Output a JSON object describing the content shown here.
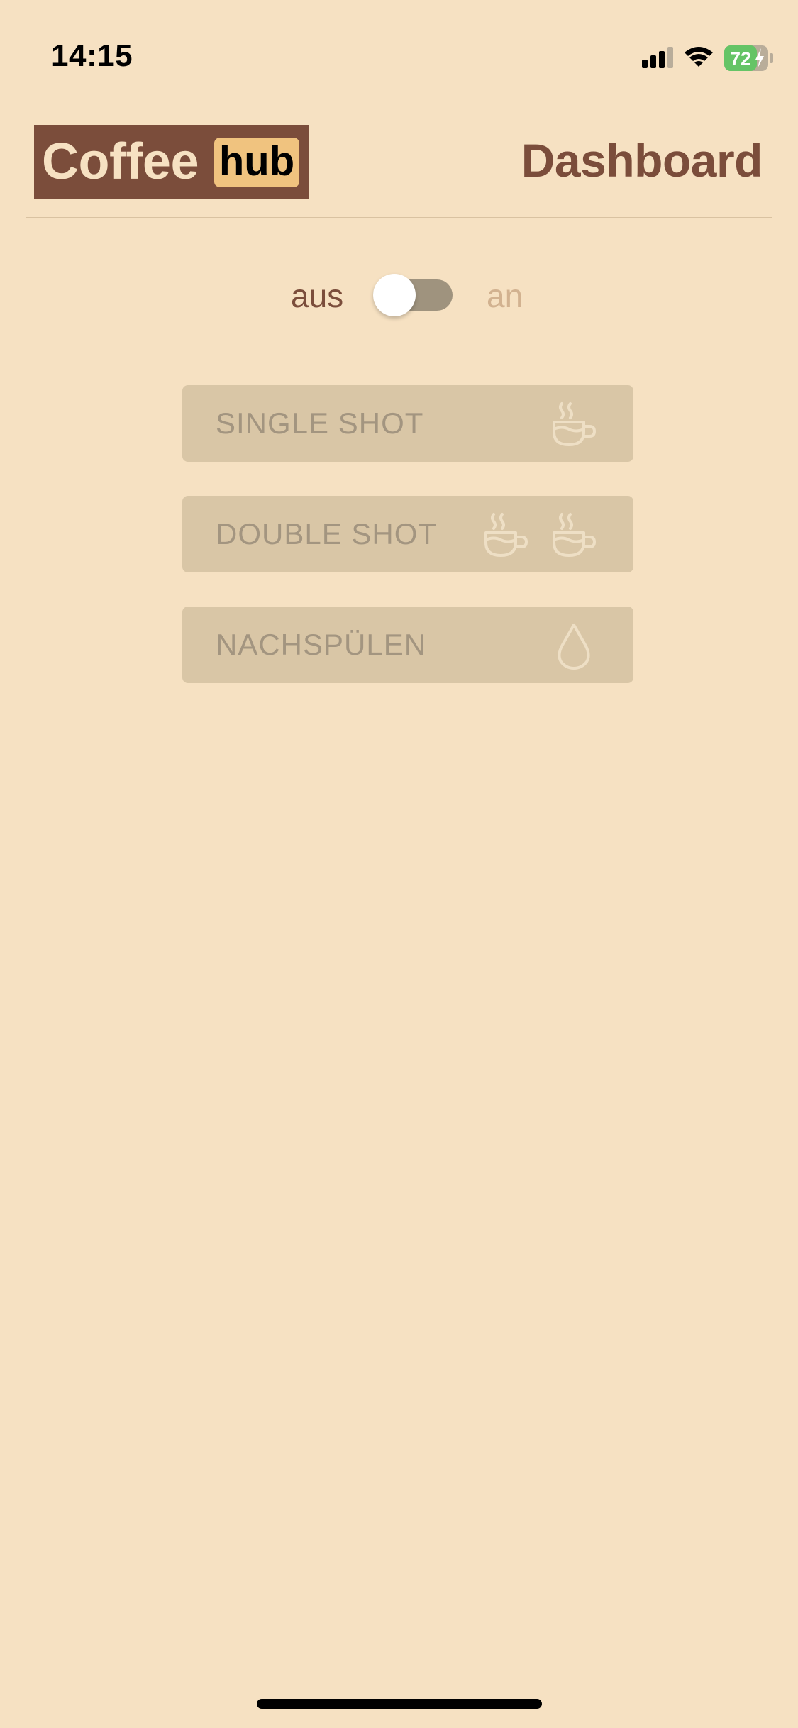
{
  "status_bar": {
    "time": "14:15",
    "battery_level": "72",
    "icons": [
      "signal-icon",
      "wifi-icon",
      "battery-icon"
    ]
  },
  "header": {
    "logo_part1": "Coffee",
    "logo_part2": "hub",
    "page_title": "Dashboard"
  },
  "power_toggle": {
    "off_label": "aus",
    "on_label": "an",
    "state": "off"
  },
  "actions": [
    {
      "label": "SINGLE SHOT",
      "icon": "coffee-cup-icon"
    },
    {
      "label": "DOUBLE SHOT",
      "icon": "double-coffee-cup-icon"
    },
    {
      "label": "NACHSPÜLEN",
      "icon": "water-drop-icon"
    }
  ],
  "colors": {
    "background": "#f6e1c2",
    "brand_brown": "#7b4d3b",
    "brand_accent": "#f0c37f",
    "button_disabled_bg": "#d9c6a6",
    "button_disabled_text": "#a39580",
    "battery_green": "#65c466"
  }
}
